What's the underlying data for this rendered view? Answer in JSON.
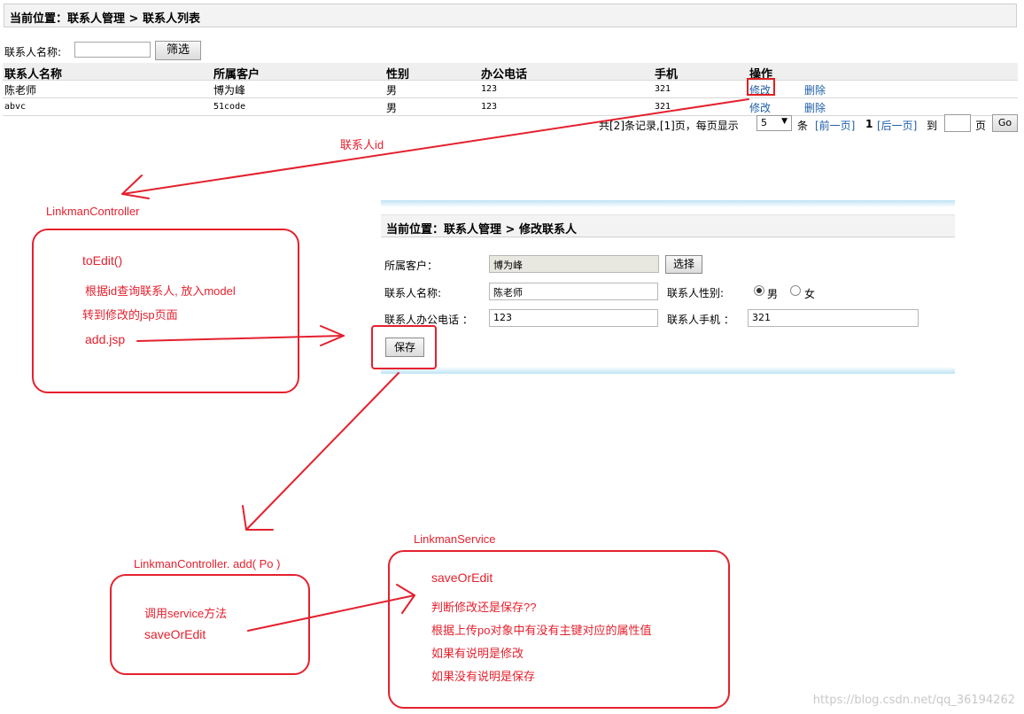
{
  "breadcrumb": {
    "text": "当前位置：联系人管理 > 联系人列表"
  },
  "filter": {
    "label": "联系人名称:",
    "value": "",
    "button": "筛选"
  },
  "table": {
    "headers": [
      "联系人名称",
      "所属客户",
      "性别",
      "办公电话",
      "手机",
      "操作"
    ],
    "rows": [
      {
        "name": "陈老师",
        "customer": "博为峰",
        "gender": "男",
        "office": "123",
        "mobile": "321",
        "edit": "修改",
        "delete": "删除"
      },
      {
        "name": "abvc",
        "customer": "51code",
        "gender": "男",
        "office": "123",
        "mobile": "321",
        "edit": "修改",
        "delete": "删除"
      }
    ]
  },
  "pager": {
    "summary": "共[2]条记录,[1]页，每页显示",
    "page_size": "5",
    "unit": "条",
    "prev": "[前一页]",
    "current": "1",
    "next": "[后一页]",
    "goto": "到",
    "page_word": "页",
    "go_button": "Go"
  },
  "annotations": {
    "linkman_id": "联系人id",
    "controller": "LinkmanController",
    "to_edit": "toEdit()",
    "query_line": "根据id查询联系人, 放入model",
    "forward_line": "转到修改的jsp页面",
    "add_jsp": "add.jsp",
    "controller_add": "LinkmanController. add( Po )",
    "call_service": "调用service方法",
    "save_or_edit_call": "saveOrEdit",
    "service": "LinkmanService",
    "save_or_edit": "saveOrEdit",
    "judge": "判断修改还是保存??",
    "judge_detail": "根据上传po对象中有没有主键对应的属性值",
    "if_has": "如果有说明是修改",
    "if_not": "如果没有说明是保存"
  },
  "edit_form": {
    "title": "当前位置：联系人管理 > 修改联系人",
    "customer_label": "所属客户：",
    "customer_value": "博为峰",
    "select_button": "选择",
    "name_label": "联系人名称:",
    "name_value": "陈老师",
    "gender_label": "联系人性别:",
    "gender_male": "男",
    "gender_female": "女",
    "gender_selected": "男",
    "office_label": "联系人办公电话 ：",
    "office_value": "123",
    "mobile_label": "联系人手机 ：",
    "mobile_value": "321",
    "save_button": "保存"
  },
  "watermark": "https://blog.csdn.net/qq_36194262",
  "colors": {
    "annotation_red": "#e4212e",
    "link_blue": "#1f5fa8"
  }
}
